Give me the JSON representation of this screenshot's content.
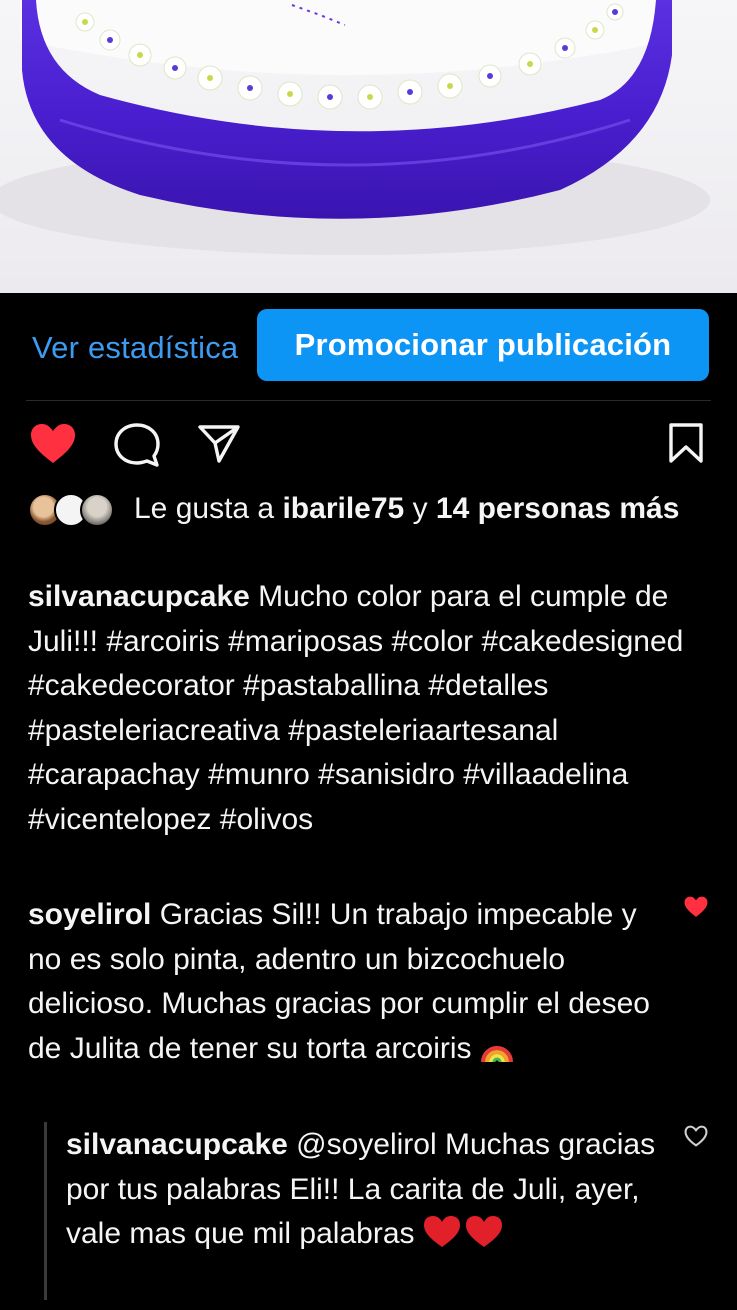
{
  "post": {
    "stats_link": "Ver estadística",
    "promote_button": "Promocionar publicación"
  },
  "actions": {
    "like_icon": "heart-filled-icon",
    "comment_icon": "comment-icon",
    "share_icon": "send-icon",
    "save_icon": "bookmark-icon",
    "like_color": "#ff3040"
  },
  "likes": {
    "prefix": "Le gusta a",
    "user": "ibarile75",
    "connector": "y",
    "others": "14 personas más"
  },
  "caption": {
    "username": "silvanacupcake",
    "text": "Mucho color para el cumple de Juli!!! #arcoiris #mariposas #color #cakedesigned #cakedecorator #pastaballina #detalles #pasteleriacreativa #pasteleriaartesanal #carapachay #munro #sanisidro #villaadelina #vicentelopez #olivos"
  },
  "comment": {
    "username": "soyelirol",
    "text": "Gracias Sil!! Un trabajo impecable y no es solo pinta, adentro un bizcochuelo delicioso. Muchas gracias por cumplir el deseo de Julita de tener su torta arcoiris",
    "liked": true
  },
  "reply": {
    "username": "silvanacupcake",
    "text": "@soyelirol Muchas gracias por tus palabras Eli!! La carita de Juli, ayer, vale mas que mil palabras",
    "liked": false
  },
  "colors": {
    "ribbon": "#4a1fd0",
    "accent_blue": "#0d95f6",
    "link_blue": "#3d9bf0"
  }
}
